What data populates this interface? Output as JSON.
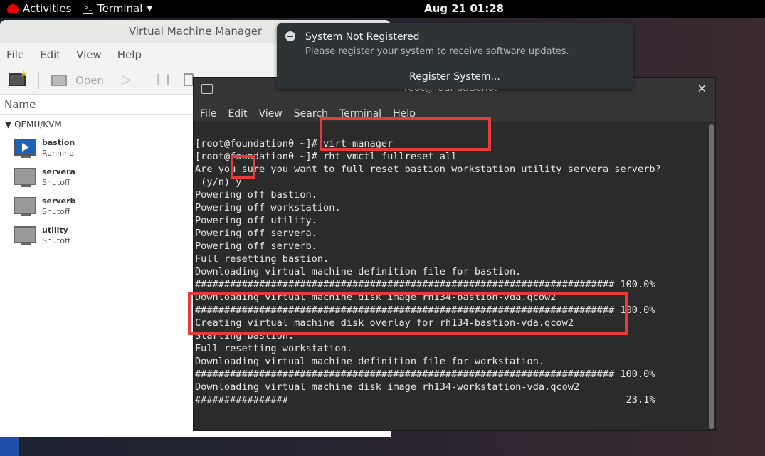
{
  "topbar": {
    "activities": "Activities",
    "app": "Terminal",
    "clock": "Aug 21  01:28"
  },
  "vmm": {
    "title": "Virtual Machine Manager",
    "menu": [
      "File",
      "Edit",
      "View",
      "Help"
    ],
    "toolbar": {
      "open_label": "Open"
    },
    "column_header": "Name",
    "group": "QEMU/KVM",
    "vms": [
      {
        "name": "bastion",
        "status": "Running"
      },
      {
        "name": "servera",
        "status": "Shutoff"
      },
      {
        "name": "serverb",
        "status": "Shutoff"
      },
      {
        "name": "utility",
        "status": "Shutoff"
      }
    ]
  },
  "notification": {
    "title": "System Not Registered",
    "body": "Please register your system to receive software updates.",
    "action": "Register System..."
  },
  "terminal": {
    "title": "root@foundation0:~",
    "menu": [
      "File",
      "Edit",
      "View",
      "Search",
      "Terminal",
      "Help"
    ],
    "lines": [
      "[root@foundation0 ~]# virt-manager",
      "[root@foundation0 ~]# rht-vmctl fullreset all",
      "Are you sure you want to full reset bastion workstation utility servera serverb?",
      " (y/n) y",
      "Powering off bastion.",
      "Powering off workstation.",
      "Powering off utility.",
      "Powering off servera.",
      "Powering off serverb.",
      "Full resetting bastion.",
      "Downloading virtual machine definition file for bastion.",
      "######################################################################## 100.0%",
      "Downloading virtual machine disk image rh134-bastion-vda.qcow2",
      "######################################################################## 100.0%",
      "Creating virtual machine disk overlay for rh134-bastion-vda.qcow2",
      "Starting bastion.",
      "Full resetting workstation.",
      "Downloading virtual machine definition file for workstation.",
      "######################################################################## 100.0%",
      "Downloading virtual machine disk image rh134-workstation-vda.qcow2",
      "################                                                          23.1%"
    ]
  }
}
